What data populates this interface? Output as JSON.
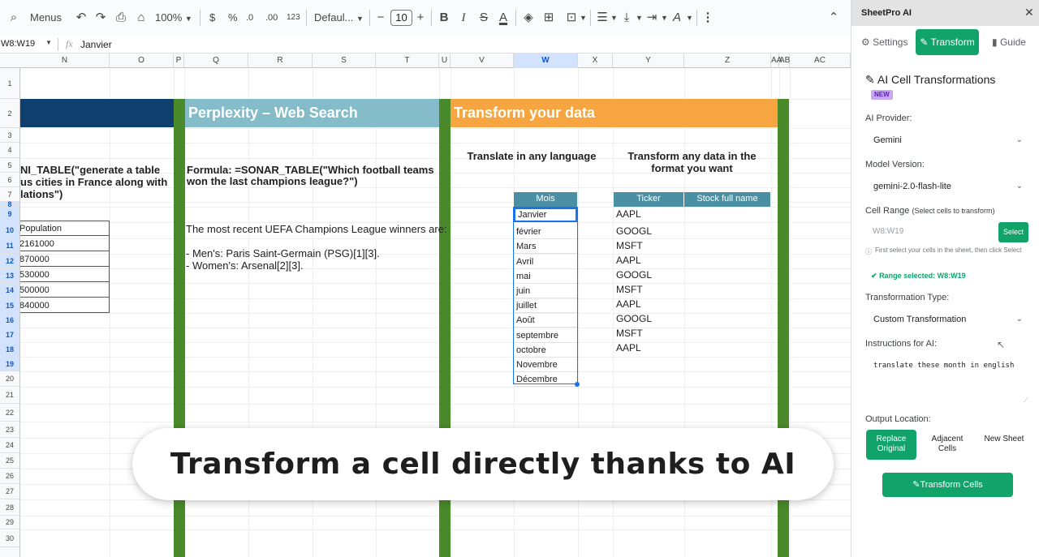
{
  "toolbar": {
    "menus": "Menus",
    "zoom": "100%",
    "currency": "$",
    "percent": "%",
    "dec_minus": ".0",
    "dec_plus": ".00",
    "format_123": "123",
    "font": "Defaul...",
    "font_size": "10",
    "minus": "−",
    "plus": "+",
    "bold": "B",
    "italic": "I",
    "strike": "S",
    "text_color": "A"
  },
  "formula_bar": {
    "name_box": "W8:W19",
    "fx": "fx",
    "content": "Janvier"
  },
  "columns": [
    {
      "label": "N",
      "selected": false
    },
    {
      "label": "O",
      "selected": false
    },
    {
      "label": "P",
      "selected": false
    },
    {
      "label": "Q",
      "selected": false
    },
    {
      "label": "R",
      "selected": false
    },
    {
      "label": "S",
      "selected": false
    },
    {
      "label": "T",
      "selected": false
    },
    {
      "label": "U",
      "selected": false
    },
    {
      "label": "V",
      "selected": false
    },
    {
      "label": "W",
      "selected": true
    },
    {
      "label": "X",
      "selected": false
    },
    {
      "label": "Y",
      "selected": false
    },
    {
      "label": "Z",
      "selected": false
    },
    {
      "label": "AA",
      "selected": false
    },
    {
      "label": "AB",
      "selected": false
    },
    {
      "label": "AC",
      "selected": false
    }
  ],
  "rows": [
    "1",
    "2",
    "3",
    "4",
    "5",
    "6",
    "7",
    "8",
    "9",
    "10",
    "11",
    "12",
    "13",
    "14",
    "15",
    "16",
    "17",
    "18",
    "19",
    "20",
    "21",
    "22",
    "23",
    "24",
    "25",
    "26",
    "27",
    "28",
    "29",
    "30"
  ],
  "sheet": {
    "banner_perplexity": "Perplexity – Web Search",
    "banner_transform": "Transform your data",
    "left_formula_line1": "NI_TABLE(\"generate a table",
    "left_formula_line2": "us cities in France along with",
    "left_formula_line3": "lations\")",
    "left_table": {
      "header": "Population",
      "values": [
        "2161000",
        "870000",
        "530000",
        "500000",
        "840000"
      ]
    },
    "perplexity_formula_line1": "Formula: =SONAR_TABLE(\"Which football teams",
    "perplexity_formula_line2": "won the last champions league?\")",
    "perplexity_result": "The most recent UEFA Champions League winners are:",
    "perplexity_men": "- Men's: Paris Saint-Germain (PSG)[1][3].",
    "perplexity_women": "- Women's: Arsenal[2][3].",
    "translate_heading": "Translate in any language",
    "format_heading_line1": "Transform any data in the",
    "format_heading_line2": "format you want",
    "mois_header": "Mois",
    "mois": [
      "Janvier",
      "février",
      "Mars",
      "Avril",
      "mai",
      "juin",
      "juillet",
      "Août",
      "septembre",
      "octobre",
      "Novembre",
      "Décembre"
    ],
    "ticker_header": "Ticker",
    "stock_header": "Stock full name",
    "tickers": [
      "AAPL",
      "GOOGL",
      "MSFT",
      "AAPL",
      "GOOGL",
      "MSFT",
      "AAPL",
      "GOOGL",
      "MSFT",
      "AAPL"
    ]
  },
  "overlay_caption": "Transform a cell directly thanks to AI",
  "panel": {
    "title": "SheetPro AI",
    "close": "✕",
    "tabs": {
      "settings": "Settings",
      "transform": "Transform",
      "guide": "Guide"
    },
    "heading": "AI Cell Transformations",
    "new_badge": "NEW",
    "provider_label": "AI Provider:",
    "provider_value": "Gemini",
    "model_label": "Model Version:",
    "model_value": "gemini-2.0-flash-lite",
    "range_label": "Cell Range",
    "range_hint": "(Select cells to transform)",
    "range_input_placeholder": "W8:W19",
    "select_button": "Select",
    "info_text": "First select your cells in the sheet, then click Select",
    "range_selected": "Range selected: W8:W19",
    "type_label": "Transformation Type:",
    "type_value": "Custom Transformation",
    "instructions_label": "Instructions for AI:",
    "instructions_value": "translate these month in english",
    "output_label": "Output Location:",
    "output_options": [
      "Replace Original",
      "Adjacent Cells",
      "New Sheet"
    ],
    "transform_button": "Transform Cells"
  },
  "colors": {
    "banner_navy": "#0f3f6e",
    "banner_teal": "#85bcc9",
    "banner_orange": "#f6a540",
    "green_divider": "#4a8a2a",
    "accent_green": "#12a36b",
    "selection_blue": "#1a73e8"
  }
}
